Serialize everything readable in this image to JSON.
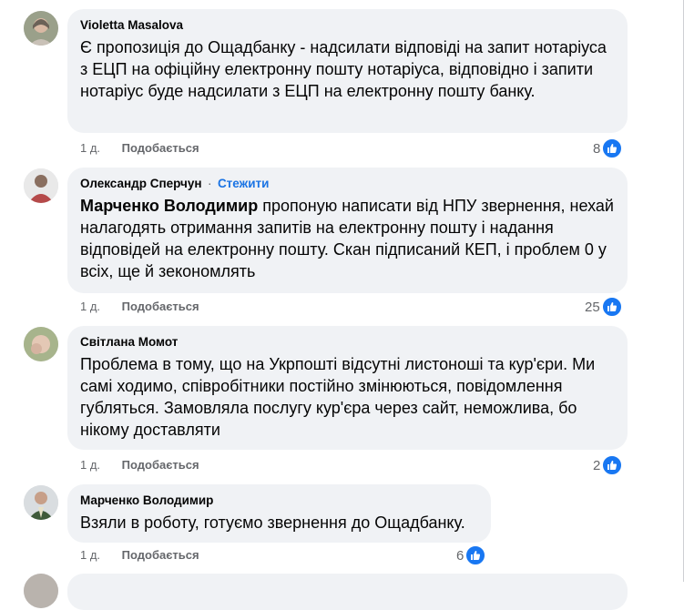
{
  "comments": [
    {
      "author": "Violetta Masalova",
      "text": "Є пропозиція до Ощадбанку - надсилати відповіді на запит нотаріуса з ЕЦП на офіційну електронну пошту нотаріуса, відповідно і запити нотаріус буде надсилати з ЕЦП на електронну пошту банку.",
      "time": "1 д.",
      "like_label": "Подобається",
      "reactions": "8"
    },
    {
      "author": "Олександр Сперчун",
      "follow_label": "Стежити",
      "mention": "Марченко Володимир",
      "text": " пропоную написати від НПУ звернення, нехай налагодять отримання запитів на електронну пошту і надання відповідей на електронну пошту. Скан підписаний КЕП, і проблем 0 у всіх, ще й зекономлять",
      "time": "1 д.",
      "like_label": "Подобається",
      "reactions": "25"
    },
    {
      "author": "Світлана Момот",
      "text": "Проблема в тому, що на Укрпошті відсутні листоноші та кур'єри. Ми самі ходимо, співробітники постійно змінюються, повідомлення губляться. Замовляла послугу кур'єра через сайт, неможлива, бо нікому доставляти",
      "time": "1 д.",
      "like_label": "Подобається",
      "reactions": "2"
    },
    {
      "author": "Марченко Володимир",
      "text": "Взяли в роботу, готуємо звернення до Ощадбанку.",
      "time": "1 д.",
      "like_label": "Подобається",
      "reactions": "6"
    }
  ],
  "colors": {
    "link": "#1b74e4",
    "bubble": "#f0f2f5",
    "like_blue": "#1877f2",
    "meta_gray": "#65676b"
  }
}
